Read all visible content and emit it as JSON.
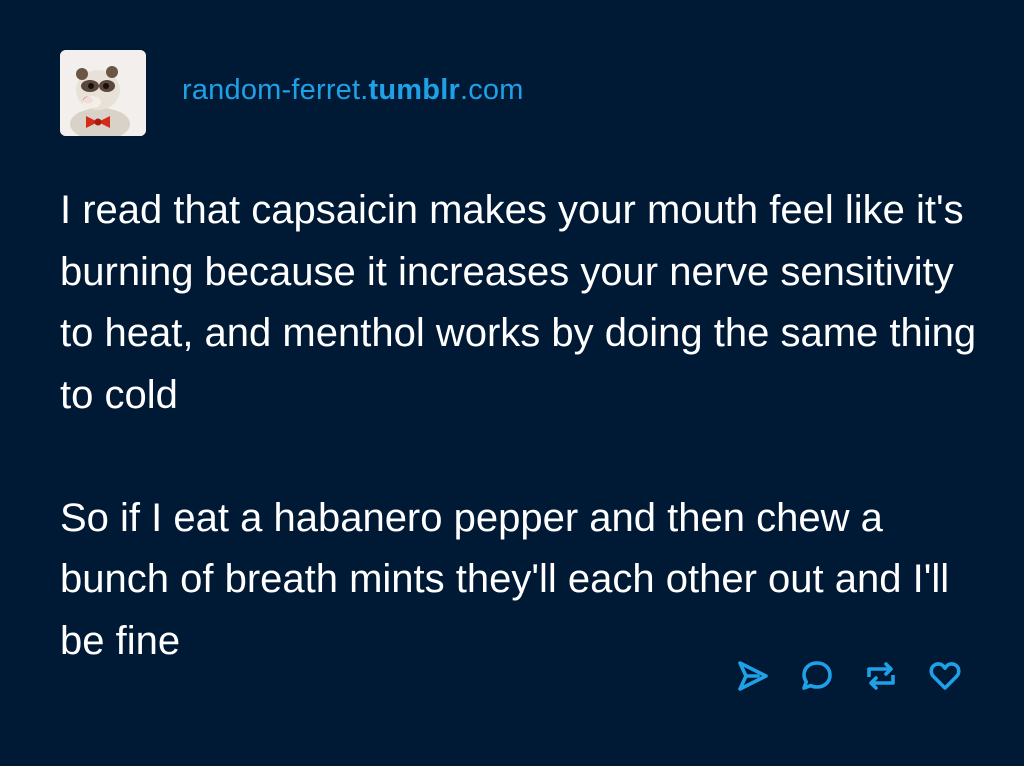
{
  "post": {
    "blog": {
      "name_prefix": "random-ferret.",
      "name_brand": "tumblr",
      "name_suffix": ".com",
      "avatar_icon": "ferret-with-red-bowtie-avatar"
    },
    "paragraphs": [
      "I read that capsaicin makes your mouth feel like it's burning because it increases your nerve sensitivity to heat, and menthol works by doing the same thing to cold",
      "So if I eat a habanero pepper and then chew a bunch of breath mints they'll each other out and I'll be fine"
    ],
    "actions": [
      {
        "icon": "share-icon"
      },
      {
        "icon": "reply-icon"
      },
      {
        "icon": "reblog-icon"
      },
      {
        "icon": "like-icon"
      }
    ]
  },
  "colors": {
    "background": "#001935",
    "accent": "#1ea1e6",
    "text": "#ffffff"
  }
}
